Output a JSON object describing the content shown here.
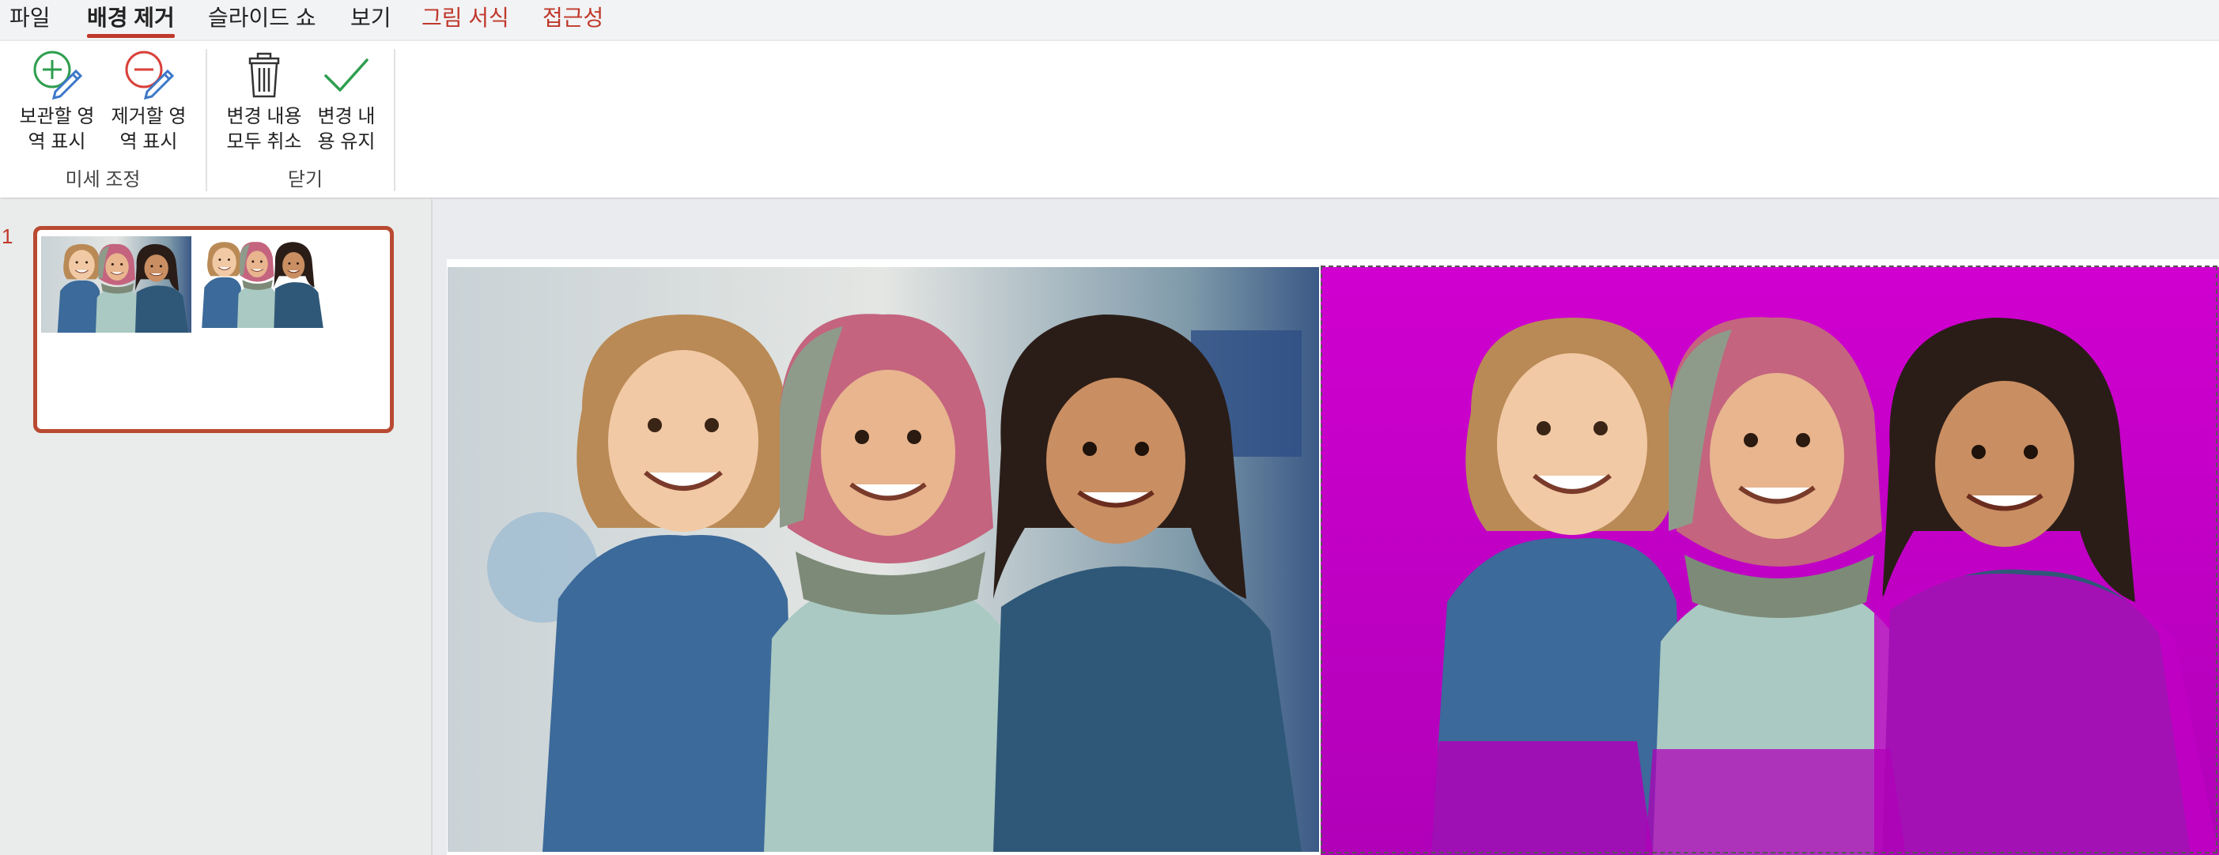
{
  "menu": {
    "tabs": [
      {
        "label": "파일"
      },
      {
        "label": "배경 제거"
      },
      {
        "label": "슬라이드 쇼"
      },
      {
        "label": "보기"
      },
      {
        "label": "그림 서식"
      },
      {
        "label": "접근성"
      }
    ],
    "active_tab": "배경 제거"
  },
  "ribbon": {
    "groups": [
      {
        "label": "미세 조정",
        "buttons": [
          {
            "label": "보관할 영\n역 표시",
            "icon": "mark-keep-icon"
          },
          {
            "label": "제거할 영\n역 표시",
            "icon": "mark-remove-icon"
          }
        ]
      },
      {
        "label": "닫기",
        "buttons": [
          {
            "label": "변경 내용\n모두 취소",
            "icon": "trash-icon"
          },
          {
            "label": "변경 내\n용 유지",
            "icon": "checkmark-icon"
          }
        ]
      }
    ]
  },
  "slides_panel": {
    "slide_number": "1"
  },
  "colors": {
    "accent": "#c0392b",
    "removal_mask": "#d600d6",
    "keep_icon": "#2e9e4e",
    "remove_icon": "#d9403a",
    "pencil": "#3c78c8"
  }
}
